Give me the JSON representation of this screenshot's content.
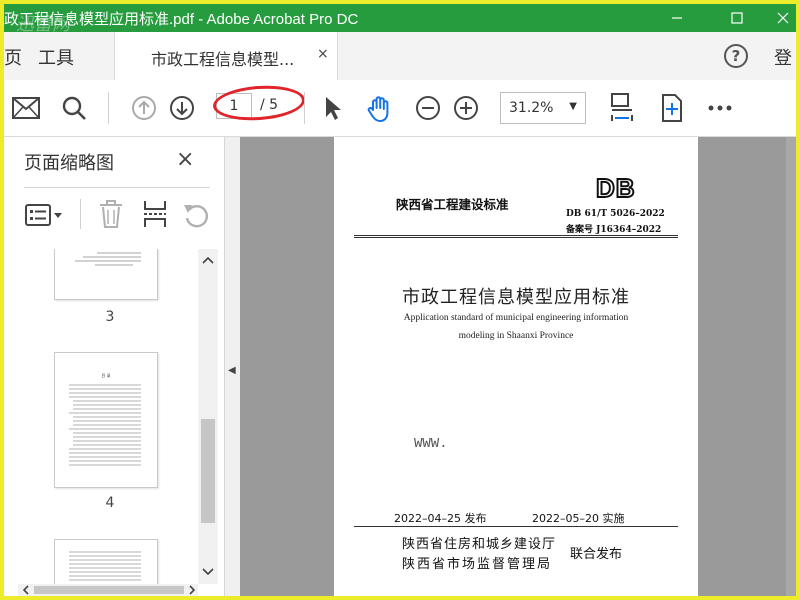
{
  "window": {
    "title": "政工程信息模型应用标准.pdf - Adobe Acrobat Pro DC",
    "watermark": "迅雷网",
    "minimize_icon": "minimize-icon",
    "maximize_icon": "maximize-icon",
    "close_icon": "close-icon"
  },
  "tabs": {
    "prev_partial": "页",
    "tools": "工具",
    "document": "市政工程信息模型...",
    "close": "×",
    "help": "?",
    "login": "登"
  },
  "toolbar": {
    "current_page": "1",
    "total_pages": "/ 5",
    "zoom": "31.2%",
    "zoom_arrow": "▼",
    "icons": [
      "mail-icon",
      "search-icon",
      "prev-page-icon",
      "next-page-icon",
      "select-arrow-icon",
      "hand-icon",
      "zoom-out-icon",
      "zoom-in-icon",
      "fit-page-icon",
      "rotate-view-icon",
      "more-icon"
    ],
    "highlight_color": "#e0242a"
  },
  "left_pane": {
    "title": "页面缩略图",
    "close": "×",
    "thumbnails": [
      {
        "label": "3"
      },
      {
        "label": "4"
      }
    ],
    "thumb_toc_heading": "目 录",
    "collapse_arrow": "◀"
  },
  "page": {
    "province_standard": "陕西省工程建设标准",
    "logo": "DB",
    "std_number": "DB  61/T  5026–2022",
    "record_number": "备案号   J16364–2022",
    "title_cn": "市政工程信息模型应用标准",
    "title_en_1": "Application standard of municipal engineering information",
    "title_en_2": "modeling in Shaanxi Province",
    "issue_date": "2022–04–25 发布",
    "impl_date": "2022–05–20 实施",
    "issuer_1": "陕西省住房和城乡建设厅",
    "issuer_2": "陕西省市场监督管理局",
    "joint": "联合发布"
  },
  "overlay": {
    "www": "WWW."
  },
  "colors": {
    "titlebar": "#279c3f",
    "frame": "#ecec2a",
    "icon_blue": "#1473e6"
  }
}
